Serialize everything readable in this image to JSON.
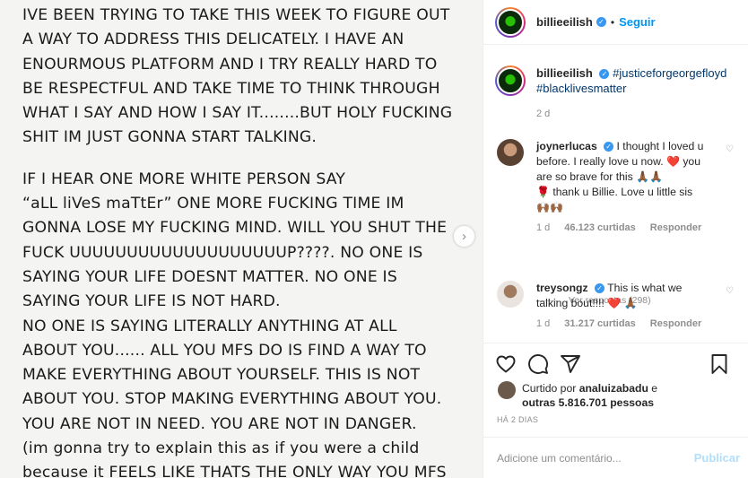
{
  "post": {
    "lines": [
      "IVE BEEN TRYING TO TAKE THIS WEEK TO FIGURE OUT",
      "A WAY TO ADDRESS THIS DELICATELY. I HAVE AN",
      "ENOURMOUS PLATFORM AND I TRY REALLY HARD TO",
      "BE RESPECTFUL AND TAKE TIME TO THINK THROUGH",
      "WHAT I SAY AND HOW I SAY IT........BUT HOLY FUCKING",
      "SHIT IM JUST GONNA START TALKING.",
      "",
      "IF I HEAR ONE MORE WHITE PERSON SAY",
      "“aLL liVeS maTtEr” ONE MORE FUCKING TIME IM",
      "GONNA LOSE MY FUCKING MIND. WILL YOU SHUT THE",
      "FUCK UUUUUUUUUUUUUUUUUUUP????. NO ONE IS",
      "SAYING YOUR LIFE DOESNT MATTER. NO ONE IS",
      "SAYING YOUR LIFE IS NOT HARD.",
      "NO ONE IS SAYING LITERALLY ANYTHING AT ALL",
      "ABOUT YOU...... ALL YOU MFS DO IS FIND A WAY TO",
      "MAKE EVERYTHING ABOUT YOURSELF. THIS IS NOT",
      "ABOUT YOU. STOP MAKING EVERYTHING ABOUT YOU.",
      "YOU ARE NOT IN NEED. YOU ARE NOT IN DANGER.",
      "(im gonna try to explain this as if you were a child",
      "because it FEELS LIKE THATS THE ONLY WAY YOU MFS"
    ],
    "next_arrow": "›"
  },
  "header": {
    "username": "billieeilish",
    "separator": "•",
    "follow_label": "Seguir"
  },
  "caption": {
    "username": "billieeilish",
    "hashtags": [
      "#justiceforgeorgefloyd",
      "#blacklivesmatter"
    ],
    "time": "2 d"
  },
  "comments": [
    {
      "username": "joynerlucas",
      "text_lines": [
        "I thought I loved u",
        "before. I really love u now.",
        "you are so brave for this",
        "thank u Billie. Love u little sis"
      ],
      "emojis": [
        "❤️",
        "🙏🏾🙏🏾",
        "🌹",
        "🙌🏾🙌🏾"
      ],
      "time": "1 d",
      "likes": "46.123 curtidas",
      "reply_label": "Responder"
    },
    {
      "username": "treysongz",
      "text_lines": [
        "This is what we",
        "talking bout!!!!"
      ],
      "emojis": [
        "❤️",
        "🙏🏾"
      ],
      "time": "1 d",
      "likes": "31.217 curtidas",
      "reply_label": "Responder"
    }
  ],
  "view_replies": "Ver respostas (298)",
  "likes": {
    "prefix": "Curtido por",
    "user": "analuizabadu",
    "connector": "e",
    "others": "outras 5.816.701 pessoas"
  },
  "posted_ago": "HÁ 2 DIAS",
  "add_comment": {
    "placeholder": "Adicione um comentário...",
    "publish_label": "Publicar"
  },
  "colors": {
    "accent": "#0095f6",
    "verified": "#3897f0",
    "publish_disabled": "#b2dffc",
    "heart_red": "#ed4956"
  },
  "icons": [
    "heart-icon",
    "comment-icon",
    "share-icon",
    "bookmark-icon",
    "verified-badge-icon",
    "chevron-right-icon"
  ]
}
